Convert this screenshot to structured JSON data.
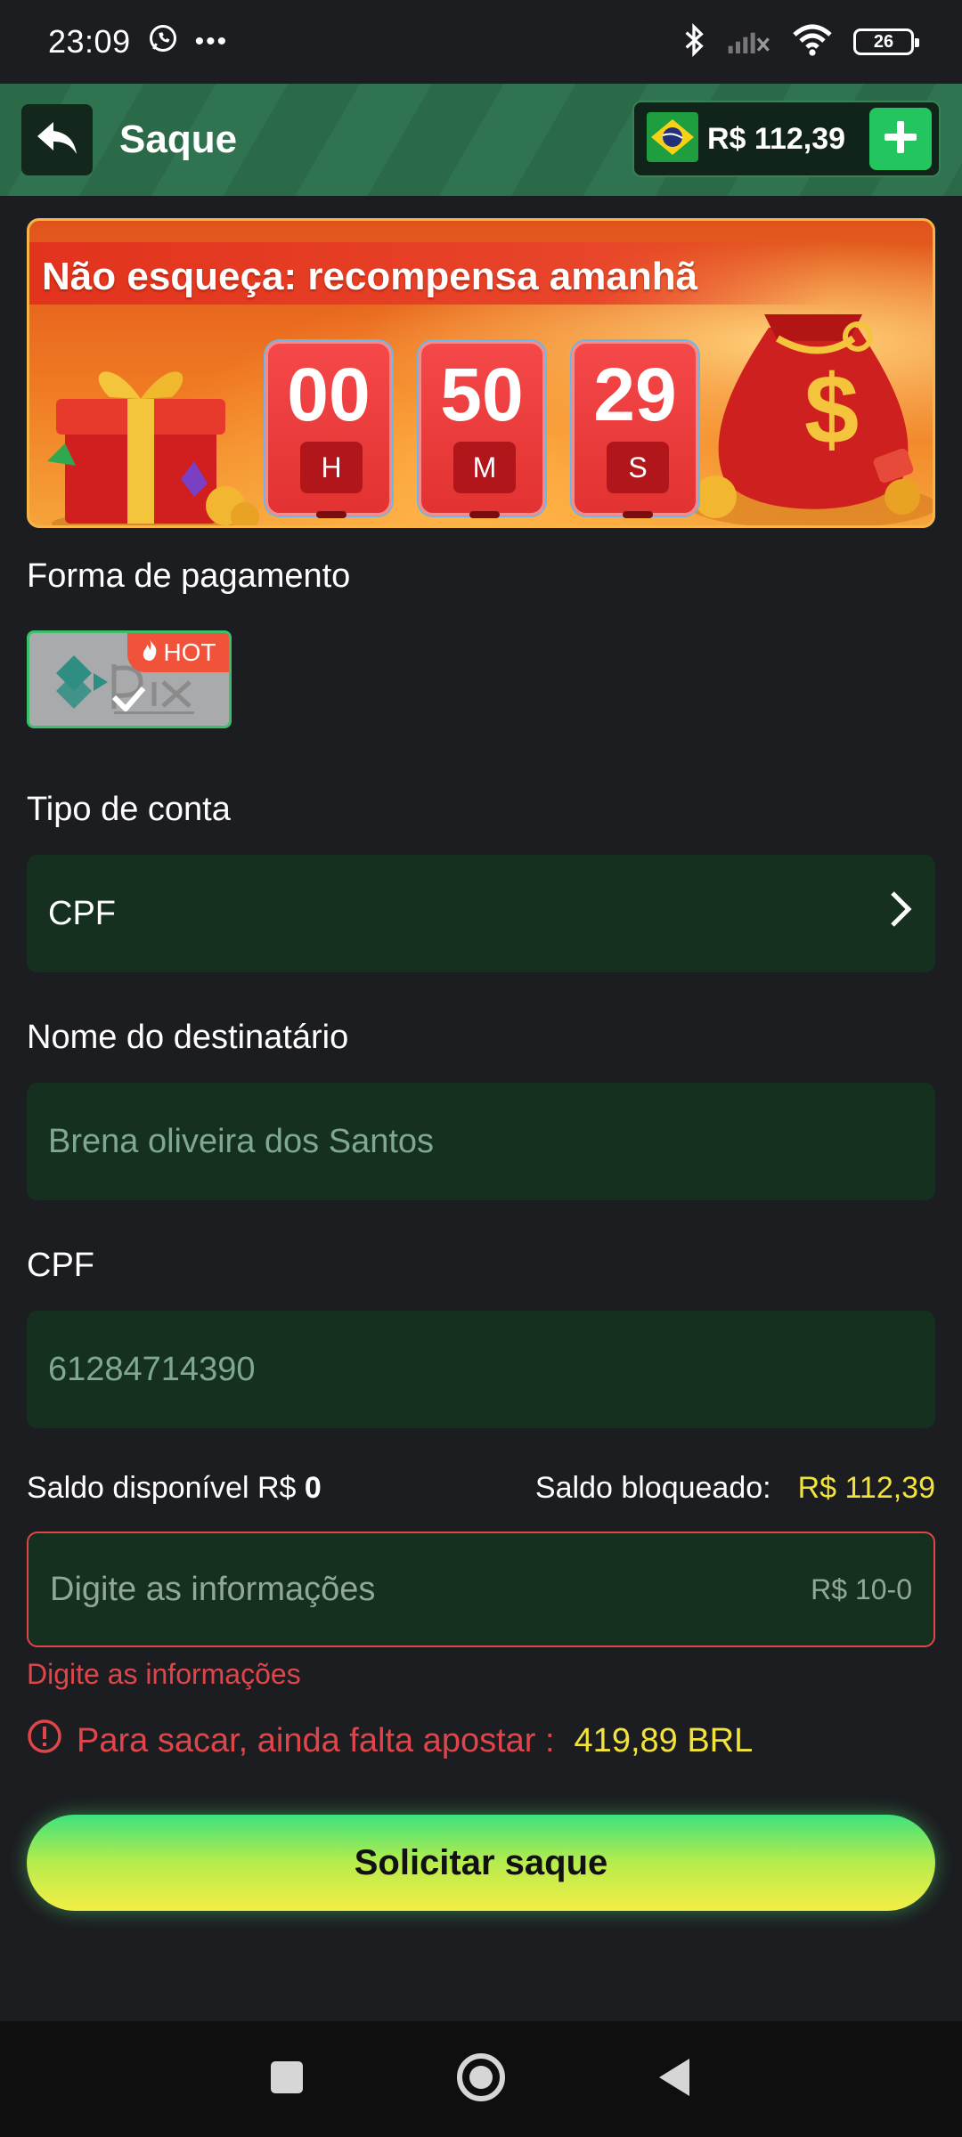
{
  "status_bar": {
    "time": "23:09",
    "more": "•••",
    "battery": "26"
  },
  "header": {
    "title": "Saque",
    "balance": "R$ 112,39"
  },
  "banner": {
    "title": "Não esqueça: recompensa amanhã",
    "countdown": [
      {
        "value": "00",
        "unit": "H"
      },
      {
        "value": "50",
        "unit": "M"
      },
      {
        "value": "29",
        "unit": "S"
      }
    ]
  },
  "payment": {
    "label": "Forma de pagamento",
    "option_badge": "HOT"
  },
  "account_type": {
    "label": "Tipo de conta",
    "value": "CPF"
  },
  "recipient": {
    "label": "Nome do destinatário",
    "value": "Brena oliveira dos Santos"
  },
  "cpf": {
    "label": "CPF",
    "value": "61284714390"
  },
  "balances": {
    "available_label": "Saldo disponível R$",
    "available_value": "0",
    "blocked_label": "Saldo bloqueado:",
    "blocked_value": "R$ 112,39"
  },
  "amount_input": {
    "placeholder": "Digite as informações",
    "range_hint": "R$ 10-0",
    "error": "Digite as informações"
  },
  "warning": {
    "text": "Para sacar, ainda falta apostar :",
    "amount": "419,89 BRL"
  },
  "submit": {
    "label": "Solicitar saque"
  },
  "colors": {
    "background": "#1c1d21",
    "field": "#16301f",
    "accent_green": "#22c55e",
    "error_red": "#e0454a",
    "highlight_yellow": "#f2e23a"
  }
}
